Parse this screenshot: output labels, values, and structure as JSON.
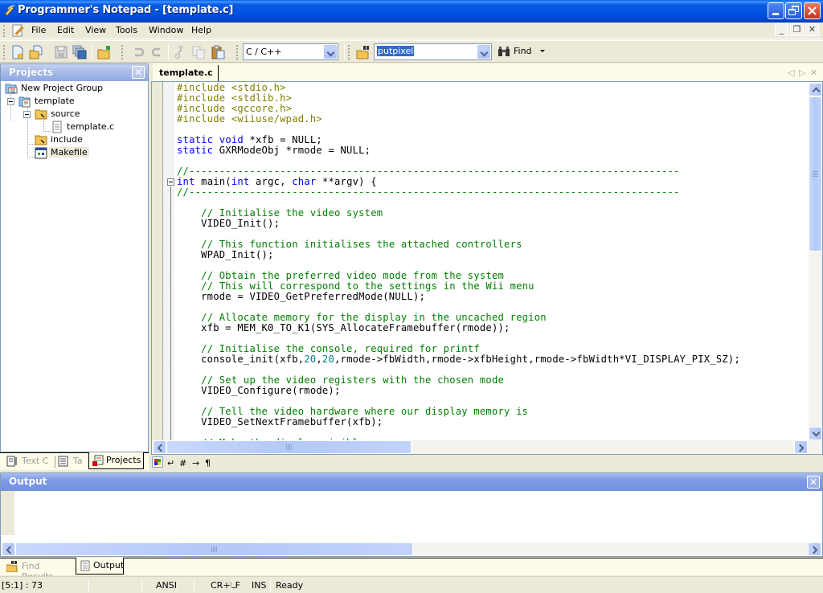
{
  "window": {
    "title": "Programmer's Notepad - [template.c]",
    "controls": {
      "minimize": "minimize",
      "maximize": "restore",
      "close": "close"
    }
  },
  "menubar": {
    "items": [
      "File",
      "Edit",
      "View",
      "Tools",
      "Window",
      "Help"
    ],
    "mdi_controls": [
      "_",
      "❐",
      "✕"
    ]
  },
  "toolbar": {
    "buttons": [
      "new-file",
      "open-file",
      "save",
      "save-all",
      "open-project",
      "undo",
      "redo",
      "cut",
      "copy",
      "paste"
    ],
    "scheme_select": {
      "value": "C / C++"
    },
    "find_input": {
      "value": "putpixel"
    },
    "find_button": "Find"
  },
  "projects_panel": {
    "title": "Projects",
    "close": "✕",
    "tree": [
      {
        "label": "New Project Group",
        "icon": "project-group-icon",
        "level": 0
      },
      {
        "label": "template",
        "icon": "project-icon",
        "level": 1,
        "expanded": true
      },
      {
        "label": "source",
        "icon": "folder-icon",
        "level": 2,
        "expanded": true
      },
      {
        "label": "template.c",
        "icon": "file-icon",
        "level": 3
      },
      {
        "label": "include",
        "icon": "folder-icon",
        "level": 2
      },
      {
        "label": "Makefile",
        "icon": "makefile-icon",
        "level": 2,
        "selected": true
      }
    ],
    "tabs": [
      {
        "label": "Text C",
        "active": false
      },
      {
        "label": "Ta",
        "active": false
      },
      {
        "label": "Projects",
        "active": true
      }
    ]
  },
  "editor": {
    "tab": "template.c",
    "lines": [
      [
        {
          "t": "#include <stdio.h>",
          "c": "pp"
        }
      ],
      [
        {
          "t": "#include <stdlib.h>",
          "c": "pp"
        }
      ],
      [
        {
          "t": "#include <gccore.h>",
          "c": "pp"
        }
      ],
      [
        {
          "t": "#include <wiiuse/wpad.h>",
          "c": "pp"
        }
      ],
      [],
      [
        {
          "t": "static",
          "c": "kw"
        },
        {
          "t": " "
        },
        {
          "t": "void",
          "c": "kw"
        },
        {
          "t": " *xfb = NULL;"
        }
      ],
      [
        {
          "t": "static",
          "c": "kw"
        },
        {
          "t": " GXRModeObj *rmode = NULL;"
        }
      ],
      [],
      [
        {
          "t": "//---------------------------------------------------------------------------------",
          "c": "cm"
        }
      ],
      [
        {
          "t": "int",
          "c": "kw"
        },
        {
          "t": " main("
        },
        {
          "t": "int",
          "c": "kw"
        },
        {
          "t": " argc, "
        },
        {
          "t": "char",
          "c": "kw"
        },
        {
          "t": " **argv) {"
        }
      ],
      [
        {
          "t": "//---------------------------------------------------------------------------------",
          "c": "cm"
        }
      ],
      [],
      [
        {
          "t": "    "
        },
        {
          "t": "// Initialise the video system",
          "c": "cm"
        }
      ],
      [
        {
          "t": "    VIDEO_Init();"
        }
      ],
      [],
      [
        {
          "t": "    "
        },
        {
          "t": "// This function initialises the attached controllers",
          "c": "cm"
        }
      ],
      [
        {
          "t": "    WPAD_Init();"
        }
      ],
      [],
      [
        {
          "t": "    "
        },
        {
          "t": "// Obtain the preferred video mode from the system",
          "c": "cm"
        }
      ],
      [
        {
          "t": "    "
        },
        {
          "t": "// This will correspond to the settings in the Wii menu",
          "c": "cm"
        }
      ],
      [
        {
          "t": "    rmode = VIDEO_GetPreferredMode(NULL);"
        }
      ],
      [],
      [
        {
          "t": "    "
        },
        {
          "t": "// Allocate memory for the display in the uncached region",
          "c": "cm"
        }
      ],
      [
        {
          "t": "    xfb = MEM_K0_TO_K1(SYS_AllocateFramebuffer(rmode));"
        }
      ],
      [],
      [
        {
          "t": "    "
        },
        {
          "t": "// Initialise the console, required for printf",
          "c": "cm"
        }
      ],
      [
        {
          "t": "    console_init(xfb,"
        },
        {
          "t": "20",
          "c": "num"
        },
        {
          "t": ","
        },
        {
          "t": "20",
          "c": "num"
        },
        {
          "t": ",rmode->fbWidth,rmode->xfbHeight,rmode->fbWidth*VI_DISPLAY_PIX_SZ);"
        }
      ],
      [],
      [
        {
          "t": "    "
        },
        {
          "t": "// Set up the video registers with the chosen mode",
          "c": "cm"
        }
      ],
      [
        {
          "t": "    VIDEO_Configure(rmode);"
        }
      ],
      [],
      [
        {
          "t": "    "
        },
        {
          "t": "// Tell the video hardware where our display memory is",
          "c": "cm"
        }
      ],
      [
        {
          "t": "    VIDEO_SetNextFramebuffer(xfb);"
        }
      ],
      [],
      [
        {
          "t": "    "
        },
        {
          "t": "// Make the display visible",
          "c": "cm"
        }
      ]
    ],
    "bottom_icons": [
      "color-scheme",
      "word-wrap",
      "line-numbers",
      "whitespace",
      "end-of-line"
    ],
    "bottom_glyphs": [
      "↵",
      "#",
      "→",
      "¶"
    ]
  },
  "output_panel": {
    "title": "Output",
    "close": "✕",
    "tabs": [
      {
        "label": "Find Results",
        "active": false
      },
      {
        "label": "Output",
        "active": true
      }
    ]
  },
  "statusbar": {
    "position": "[5:1] : 73",
    "blank": "",
    "encoding": "ANSI",
    "line_ending": "CR+LF",
    "mode": "INS",
    "status": "Ready"
  }
}
